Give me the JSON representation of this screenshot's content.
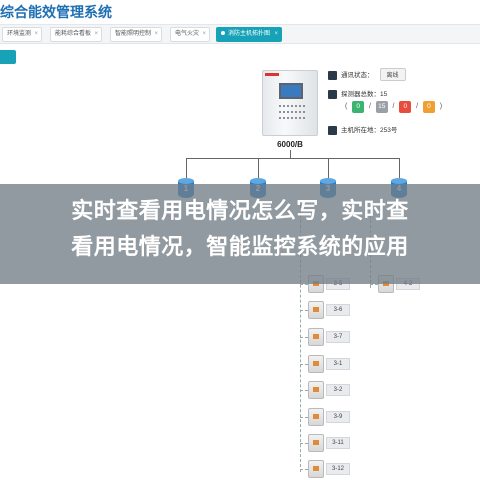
{
  "app": {
    "title": "综合能效管理系统"
  },
  "tabs": [
    {
      "label": "环境监测",
      "close": "×"
    },
    {
      "label": "能耗综合看板",
      "close": "×"
    },
    {
      "label": "智能照明控制",
      "close": "×"
    },
    {
      "label": "电气火灾",
      "close": "×"
    },
    {
      "label": "消防主机拓扑图",
      "close": "×",
      "active": true
    }
  ],
  "device": {
    "model": "6000/B"
  },
  "status": {
    "comm_label": "通讯状态：",
    "comm_value": "离线",
    "detectors_label": "探测器总数：15",
    "counts": [
      {
        "value": "0",
        "color": "#3cb371"
      },
      {
        "value": "15",
        "color": "#9aa0a6"
      },
      {
        "value": "0",
        "color": "#e74c3c"
      },
      {
        "value": "0",
        "color": "#f0a030"
      }
    ],
    "separator": "/",
    "open": "(",
    "close": ")",
    "host_address": "主机所在地：253号"
  },
  "branches": [
    "1",
    "2",
    "3",
    "4"
  ],
  "banner": {
    "line1": "实时查看用电情况怎么写，实时查",
    "line2": "看用电情况，智能监控系统的应用"
  },
  "nodes_col3": [
    "3-5",
    "3-6",
    "3-7",
    "3-1",
    "3-2",
    "3-9",
    "3-11",
    "3-12"
  ],
  "nodes_col4": [
    "4-2"
  ]
}
